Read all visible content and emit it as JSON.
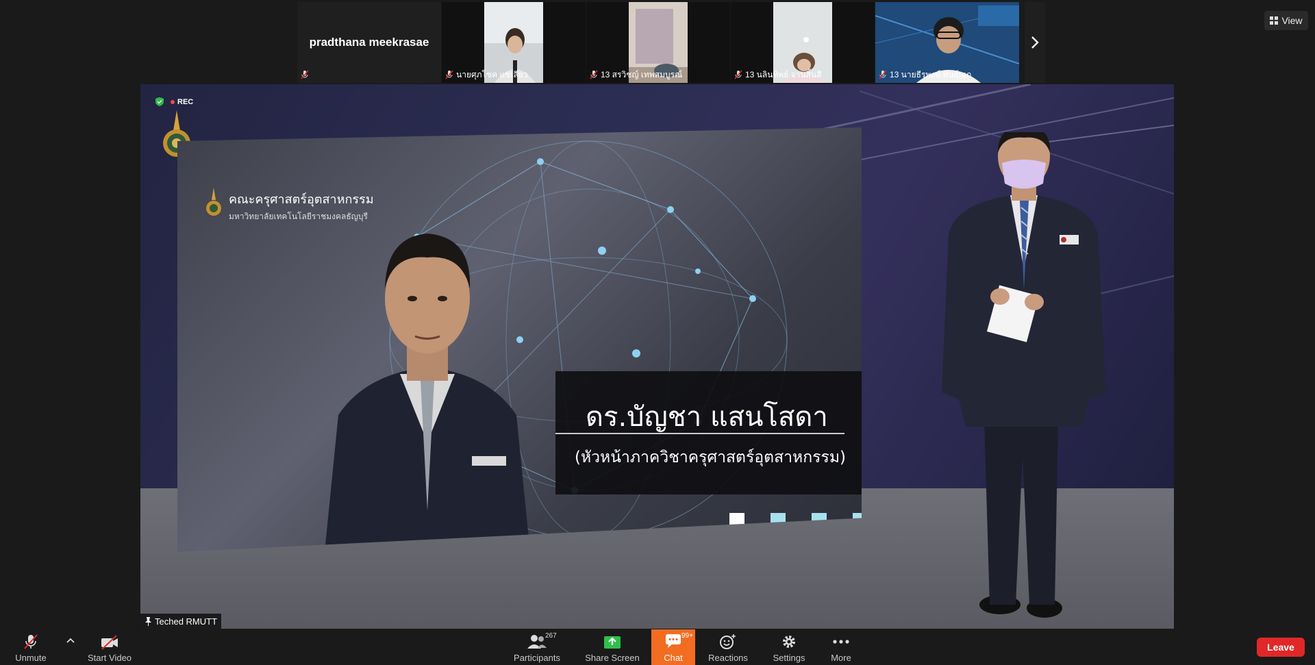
{
  "gallery": {
    "tiles": [
      {
        "name": "pradthana meekrasae",
        "label": ""
      },
      {
        "label": "นายศุภโชค แซ่เลียว"
      },
      {
        "label": "13 สรวิชญ์ เทพสมบูรณ์"
      },
      {
        "label": "13 นลินทิพย์ จานสิ้นสี"
      },
      {
        "label": "13 นายธีรพงษ์ พันธุ์เอก"
      }
    ]
  },
  "view_button": {
    "label": "View"
  },
  "recording": {
    "label": "REC"
  },
  "slide": {
    "faculty_name": "คณะครุศาสตร์อุตสาหกรรม",
    "university_name": "มหาวิทยาลัยเทคโนโลยีราชมงคลธัญบุรี",
    "speaker_name": "ดร.บัญชา แสนโสดา",
    "speaker_role": "(หัวหน้าภาควิชาครุศาสตร์อุตสาหกรรม)"
  },
  "active_speaker": {
    "name": "Teched RMUTT"
  },
  "toolbar": {
    "unmute": "Unmute",
    "start_video": "Start Video",
    "participants": "Participants",
    "participants_count": "267",
    "share_screen": "Share Screen",
    "chat": "Chat",
    "chat_count": "99+",
    "reactions": "Reactions",
    "settings": "Settings",
    "more": "More",
    "leave": "Leave"
  },
  "colors": {
    "chat_active": "#f26d21",
    "leave": "#e02828",
    "share_green": "#2fbf4a",
    "rec_red": "#f04a4a"
  }
}
